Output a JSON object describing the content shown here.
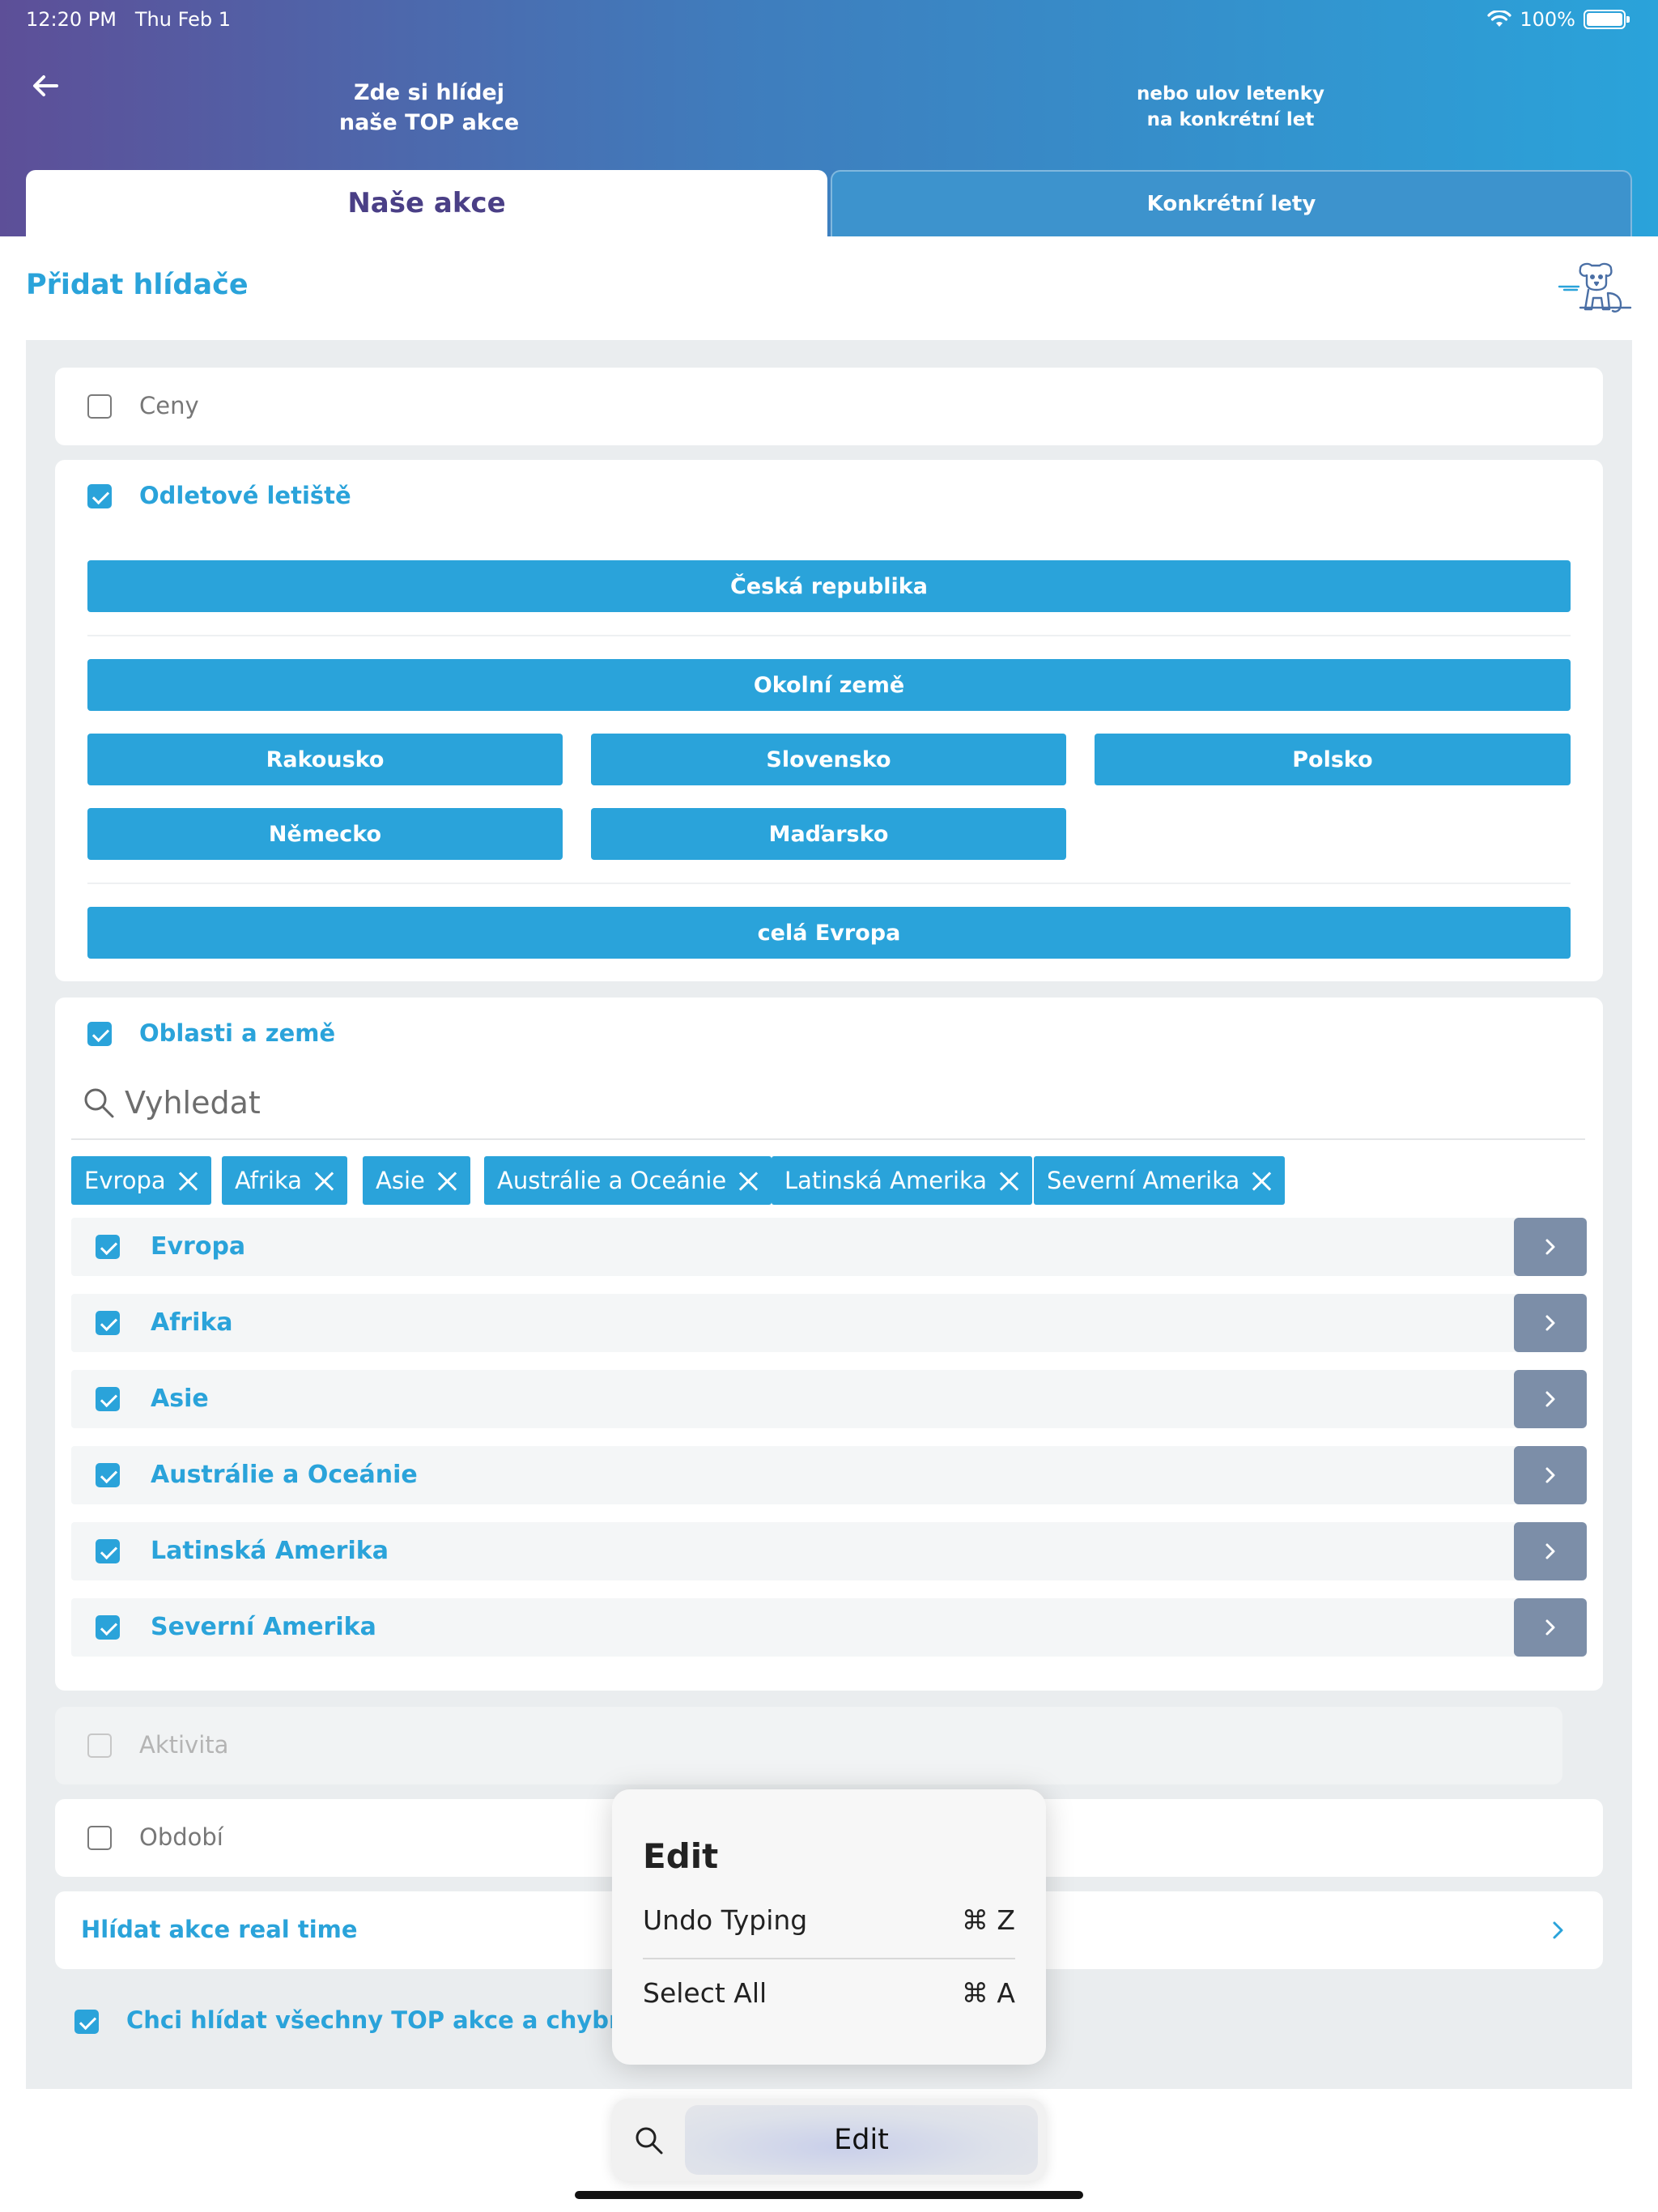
{
  "status": {
    "time": "12:20 PM",
    "date": "Thu Feb 1",
    "battery": "100%"
  },
  "header": {
    "left_line1": "Zde si hlídej",
    "left_line2": "naše TOP akce",
    "right_line1": "nebo ulov letenky",
    "right_line2": "na konkrétní let"
  },
  "tabs": {
    "active": "Naše akce",
    "inactive": "Konkrétní lety"
  },
  "section_title": "Přidat hlídače",
  "ceny": {
    "label": "Ceny",
    "checked": false
  },
  "airports": {
    "label": "Odletové letiště",
    "cz": "Česká republika",
    "neighbors": "Okolní země",
    "countries": [
      "Rakousko",
      "Slovensko",
      "Polsko",
      "Německo",
      "Maďarsko"
    ],
    "europe": "celá Evropa"
  },
  "regions": {
    "label": "Oblasti a země",
    "search_placeholder": "Vyhledat",
    "chips": [
      "Evropa",
      "Afrika",
      "Asie",
      "Austrálie a Oceánie",
      "Latinská Amerika",
      "Severní Amerika"
    ],
    "items": [
      "Evropa",
      "Afrika",
      "Asie",
      "Austrálie a Oceánie",
      "Latinská Amerika",
      "Severní Amerika"
    ]
  },
  "aktivita": {
    "label": "Aktivita"
  },
  "obdobi": {
    "label": "Období"
  },
  "realtime": {
    "label": "Hlídat akce real time"
  },
  "all_top": {
    "label": "Chci hlídat všechny TOP akce a chybné tarify"
  },
  "popover": {
    "title": "Edit",
    "undo": "Undo Typing",
    "undo_shortcut": "⌘ Z",
    "select_all": "Select All",
    "select_all_shortcut": "⌘ A"
  },
  "toolbar": {
    "edit": "Edit"
  },
  "colors": {
    "accent": "#2aa3da",
    "header_start": "#5d4f98",
    "chevron_btn": "#7c8ea8"
  }
}
